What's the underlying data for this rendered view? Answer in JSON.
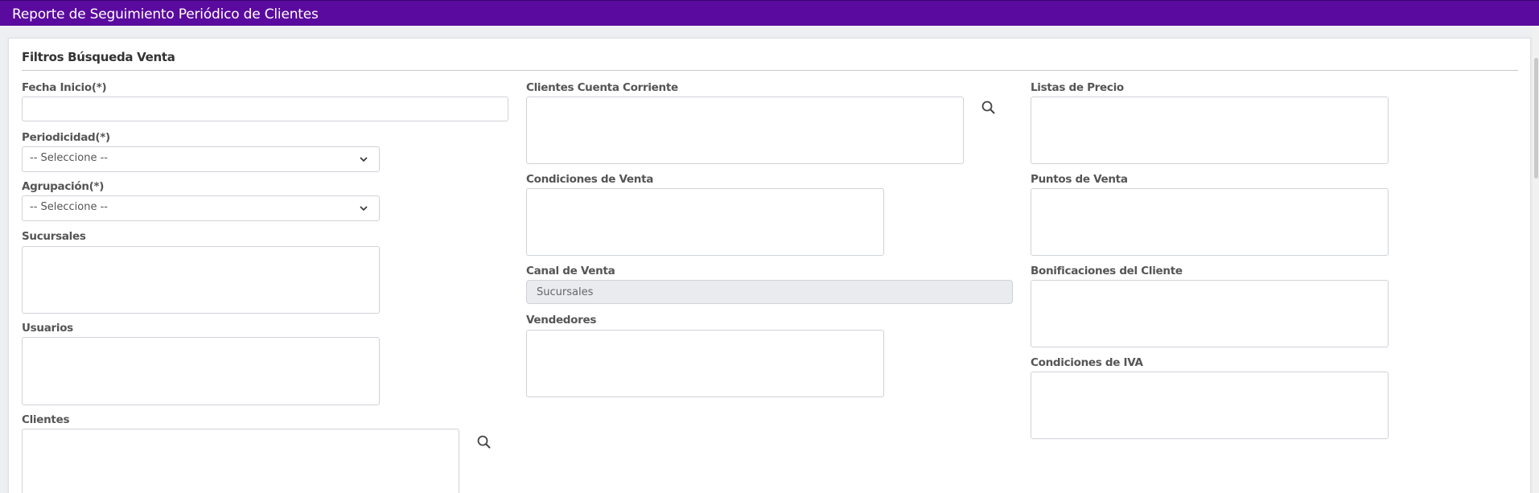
{
  "page": {
    "title": "Reporte de Seguimiento Periódico de Clientes"
  },
  "filters": {
    "section_title": "Filtros Búsqueda Venta",
    "fecha_inicio": {
      "label": "Fecha Inicio(*)",
      "value": ""
    },
    "periodicidad": {
      "label": "Periodicidad(*)",
      "selected": "-- Seleccione --"
    },
    "agrupacion": {
      "label": "Agrupación(*)",
      "selected": "-- Seleccione --"
    },
    "sucursales": {
      "label": "Sucursales"
    },
    "usuarios": {
      "label": "Usuarios"
    },
    "clientes": {
      "label": "Clientes"
    },
    "clientes_cuenta_corriente": {
      "label": "Clientes Cuenta Corriente"
    },
    "condiciones_venta": {
      "label": "Condiciones de Venta"
    },
    "canal_venta": {
      "label": "Canal de Venta",
      "value": "Sucursales"
    },
    "vendedores": {
      "label": "Vendedores"
    },
    "listas_precio": {
      "label": "Listas de Precio"
    },
    "puntos_venta": {
      "label": "Puntos de Venta"
    },
    "bonificaciones_cliente": {
      "label": "Bonificaciones del Cliente"
    },
    "condiciones_iva": {
      "label": "Condiciones de IVA"
    }
  },
  "icons": {
    "search": "search-icon",
    "chevron": "chevron-down-icon"
  },
  "colors": {
    "header_bg": "#5a0a9e",
    "header_text": "#ffffff",
    "readonly_bg": "#e9ebef"
  }
}
